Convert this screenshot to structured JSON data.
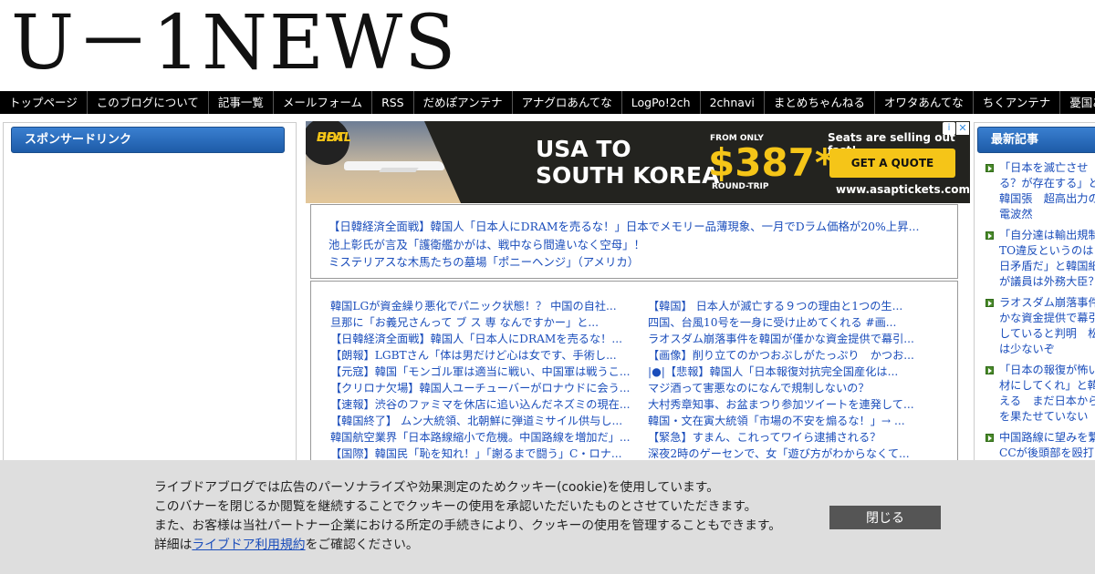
{
  "site": {
    "logo_text": "U－1NEWS"
  },
  "nav": {
    "items": [
      "トップページ",
      "このブログについて",
      "記事一覧",
      "メールフォーム",
      "RSS",
      "だめぽアンテナ",
      "アナグロあんてな",
      "LogPo!2ch",
      "2chnavi",
      "まとめちゃんねる",
      "オワタあんてな",
      "ちくアンテナ",
      "憂国あんてな"
    ]
  },
  "sidebar_left": {
    "title": "スポンサードリンク"
  },
  "sidebar_right": {
    "title": "最新記事",
    "items": [
      "「日本を滅亡させる？が存在する」と韓国張　超高出力の電波然",
      "「自分達は輸出規制TO違反というのは日矛盾だ」と韓国紙が議員は外務大臣？",
      "ラオスダム崩落事件かな資金提供で幕引していると判明　松は少ないぞ",
      "「日本の報復が怖い材にしてくれ」と韓える　まだ日本からを果たせていない",
      "中国路線に望みを繋CCが後頭部を殴打"
    ]
  },
  "ad": {
    "badge_line1": "HOT",
    "badge_line2": "DEAL",
    "headline_line1": "USA TO",
    "headline_line2": "SOUTH KOREA",
    "from_label": "FROM ONLY",
    "price": "$387*",
    "trip_label": "ROUND-TRIP",
    "seats_text": "Seats are selling out fast!",
    "cta": "GET A QUOTE",
    "url": "www.asaptickets.com",
    "info_icon": "i",
    "close_icon": "✕"
  },
  "featured": {
    "items": [
      "【日韓経済全面戦】韓国人「日本人にDRAMを売るな！」日本でメモリー品薄現象、一月でDラム価格が20%上昇...",
      "池上彰氏が言及「護衛艦かがは、戦中なら間違いなく空母」！",
      "ミステリアスな木馬たちの墓場「ポニーヘンジ」（アメリカ）"
    ]
  },
  "articles": {
    "left": [
      "韓国LGが資金繰り悪化でパニック状態！？ 中国の自社...",
      "旦那に「お義兄さんって ブ ス 専 なんですかー」と...",
      "【日韓経済全面戦】韓国人「日本人にDRAMを売るな！...",
      "【朗報】LGBTさん「体は男だけど心は女です、手術し...",
      "【元寇】韓国「モンゴル軍は適当に戦い、中国軍は戦うこ...",
      "【クリロナ欠場】韓国人ユーチューバーがロナウドに会う...",
      "【速報】渋谷のファミマを休店に追い込んだネズミの現在...",
      "【韓国終了】 ムン大統領、北朝鮮に弾道ミサイル供与し...",
      "韓国航空業界「日本路線縮小で危機。中国路線を増加だ」...",
      "【国際】韓国民「恥を知れ！」「謝るまで闘う」C・ロナ..."
    ],
    "right": [
      "【韓国】 日本人が滅亡する９つの理由と1つの生...",
      "四国、台風10号を一身に受け止めてくれる #画...",
      "ラオスダム崩落事件を韓国が僅かな資金提供で幕引...",
      "【画像】削り立てのかつおぶしがたっぷり　かつお...",
      "|●|【悲報】韓国人「日本報復対抗完全国産化は...",
      "マジ酒って害悪なのになんで規制しないの？",
      "大村秀章知事、お盆まつり参加ツイートを連発して...",
      "韓国・文在寅大統領「市場の不安を煽るな！」→ ...",
      "【緊急】すまん、これってワイら逮捕される？",
      "深夜2時のゲーセンで、女「遊び方がわからなくて..."
    ]
  },
  "cookie": {
    "line1": "ライブドアブログでは広告のパーソナライズや効果測定のためクッキー(cookie)を使用しています。",
    "line2": "このバナーを閉じるか閲覧を継続することでクッキーの使用を承認いただいたものとさせていただきます。",
    "line3": "また、お客様は当社パートナー企業における所定の手続きにより、クッキーの使用を管理することもできます。",
    "line4_prefix": "詳細は",
    "line4_link": "ライブドア利用規約",
    "line4_suffix": "をご確認ください。",
    "close_label": "閉じる"
  }
}
